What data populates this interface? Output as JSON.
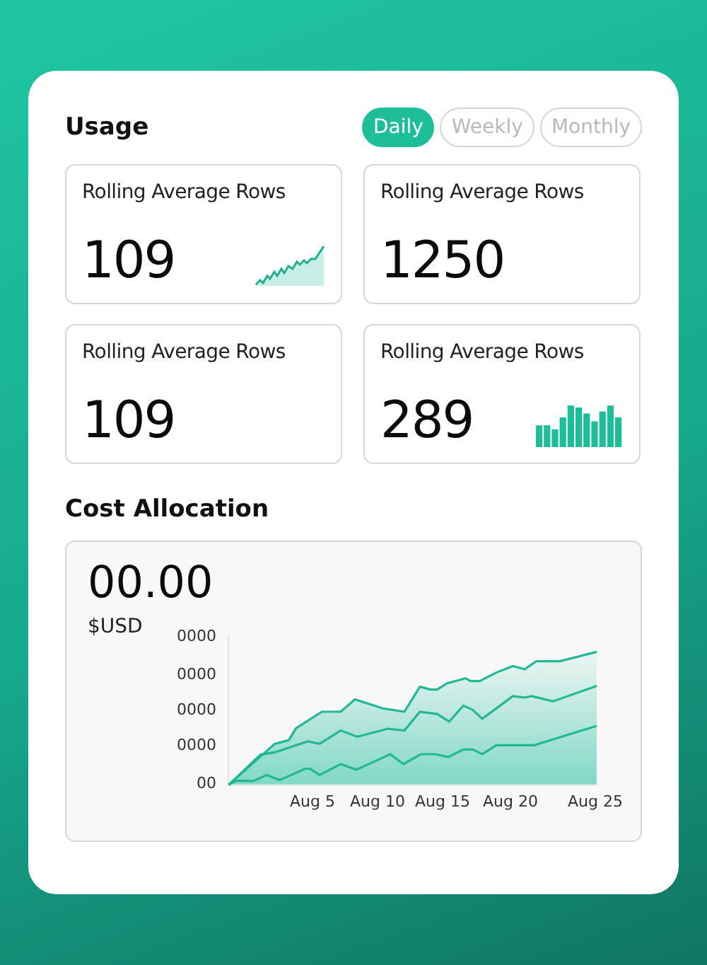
{
  "usage": {
    "title": "Usage",
    "tabs": [
      {
        "label": "Daily",
        "selected": true
      },
      {
        "label": "Weekly",
        "selected": false
      },
      {
        "label": "Monthly",
        "selected": false
      }
    ],
    "cards": [
      {
        "label": "Rolling Average Rows",
        "value": "109",
        "kind": "line"
      },
      {
        "label": "Rolling Average Rows",
        "value": "1250",
        "kind": "plain"
      },
      {
        "label": "Rolling Average Rows",
        "value": "109",
        "kind": "plain"
      },
      {
        "label": "Rolling Average Rows",
        "value": "289",
        "kind": "bars"
      }
    ]
  },
  "cost_allocation": {
    "title": "Cost Allocation",
    "amount": "00.00",
    "currency": "$USD",
    "y_tick_labels": [
      "0000",
      "0000",
      "0000",
      "0000",
      "00"
    ],
    "x_tick_labels": [
      "Aug 5",
      "Aug 10",
      "Aug 15",
      "Aug 20",
      "Aug 25"
    ]
  }
}
